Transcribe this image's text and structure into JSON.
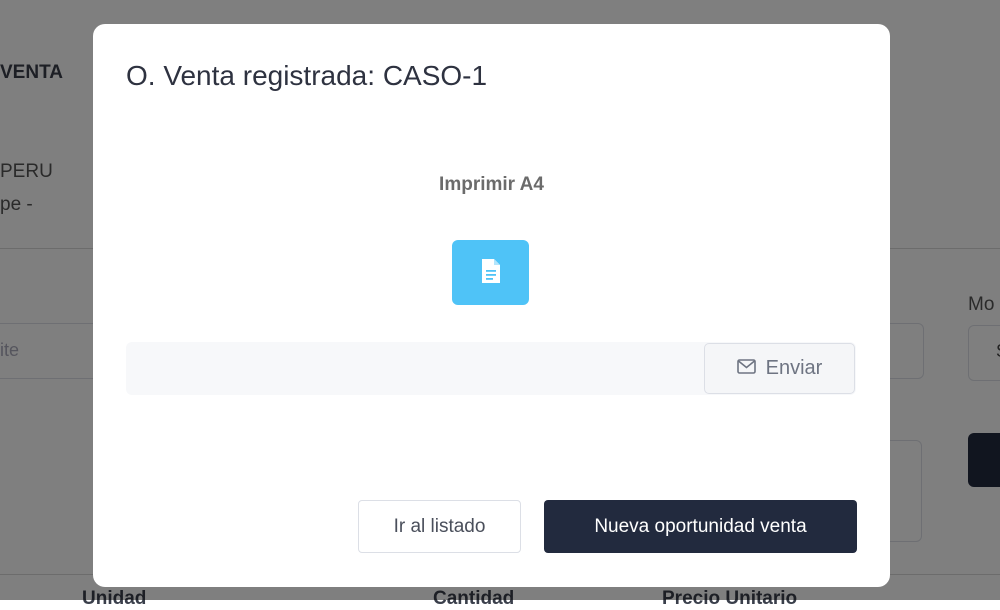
{
  "background": {
    "title_fragment": "VENTA",
    "line1_fragment": "PERU",
    "line2_fragment": "pe -",
    "input_placeholder_fragment": "ite",
    "right_label_fragment": "Mo",
    "right_select_fragment": "S",
    "table_headers": [
      "Unidad",
      "Cantidad",
      "Precio Unitario"
    ]
  },
  "modal": {
    "title": "O. Venta registrada: CASO-1",
    "print_label": "Imprimir A4",
    "print_icon": "document-icon",
    "email_input_value": "",
    "send_button_label": "Enviar",
    "send_icon": "envelope-icon",
    "secondary_button_label": "Ir al listado",
    "primary_button_label": "Nueva oportunidad venta"
  },
  "colors": {
    "print_button": "#4fc3f7",
    "primary_button": "#222a3e",
    "overlay": "rgba(0,0,0,0.5)"
  }
}
